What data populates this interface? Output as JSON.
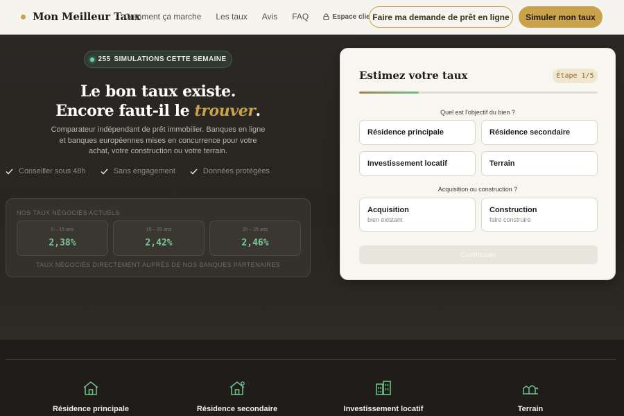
{
  "nav": {
    "brand": "Mon Meilleur Taux",
    "links": [
      "Comment ça marche",
      "Les taux",
      "Avis",
      "FAQ"
    ],
    "client_label": "Espace client",
    "cta_outline": "Faire ma demande de prêt en ligne",
    "cta_solid": "Simuler mon taux"
  },
  "hero": {
    "badge_count": "255",
    "badge_text": "SIMULATIONS CETTE SEMAINE",
    "headline_line1": "Le bon taux existe.",
    "headline_line2_prefix": "Encore faut-il le ",
    "headline_line2_accent": "trouver",
    "headline_line2_suffix": ".",
    "subtitle": "Comparateur indépendant de prêt immobilier. Banques en ligne et banques européennes mises en concurrence pour votre achat, votre construction ou votre terrain.",
    "checks": [
      "Conseiller sous 48h",
      "Sans engagement",
      "Données protégées"
    ]
  },
  "rates": {
    "title": "NOS TAUX NÉGOCIÉS ACTUELS",
    "items": [
      {
        "range": "0 – 15 ans",
        "value": "2,38%"
      },
      {
        "range": "15 – 20 ans",
        "value": "2,42%"
      },
      {
        "range": "20 – 25 ans",
        "value": "2,46%"
      }
    ],
    "footer": "TAUX NÉGOCIÉS DIRECTEMENT AUPRÈS DE NOS BANQUES PARTENAIRES"
  },
  "form": {
    "title": "Estimez votre taux",
    "step": "Étape 1/5",
    "progress": 0.25,
    "question1": "Quel est l'objectif du bien ?",
    "options1": [
      "Résidence principale",
      "Résidence secondaire",
      "Investissement locatif",
      "Terrain"
    ],
    "question2": "Acquisition ou construction ?",
    "options2": [
      {
        "label": "Acquisition",
        "sub": "bien existant"
      },
      {
        "label": "Construction",
        "sub": "faire construire"
      }
    ],
    "continue": "Continuer"
  },
  "bottom": {
    "items": [
      {
        "label": "Résidence principale",
        "icon": "house-icon"
      },
      {
        "label": "Résidence secondaire",
        "icon": "house-plus-icon"
      },
      {
        "label": "Investissement locatif",
        "icon": "buildings-icon"
      },
      {
        "label": "Terrain",
        "icon": "land-icon"
      }
    ]
  },
  "colors": {
    "accent": "#c9a24b",
    "green": "#7cc79a",
    "dark_bg": "#2a2724",
    "nav_bg": "#f6f4ef"
  }
}
